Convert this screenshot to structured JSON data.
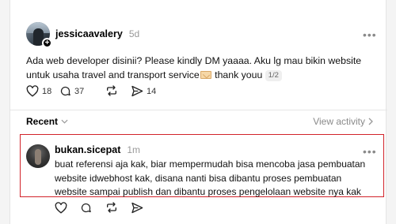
{
  "post": {
    "username": "jessicaavalery",
    "time": "5d",
    "text_before_emoji": "Ada web developer disinii? Please kindly DM yaaaa. Aku lg mau bikin website untuk usaha travel and transport service",
    "emoji": "love-letter-emoji",
    "text_after_emoji": " thank youu ",
    "page_indicator": "1/2",
    "likes": "18",
    "comments": "37",
    "shares": "14"
  },
  "filter": {
    "recent_label": "Recent",
    "view_activity_label": "View activity"
  },
  "reply": {
    "username": "bukan.sicepat",
    "time": "1m",
    "text": "buat referensi aja kak, biar mempermudah bisa mencoba jasa pembuatan website idwebhost kak, disana nanti bisa dibantu proses pembuatan website sampai publish dan dibantu proses pengelolaan website nya kak"
  },
  "colors": {
    "highlight_border": "#d2232a",
    "muted_text": "#999999"
  }
}
